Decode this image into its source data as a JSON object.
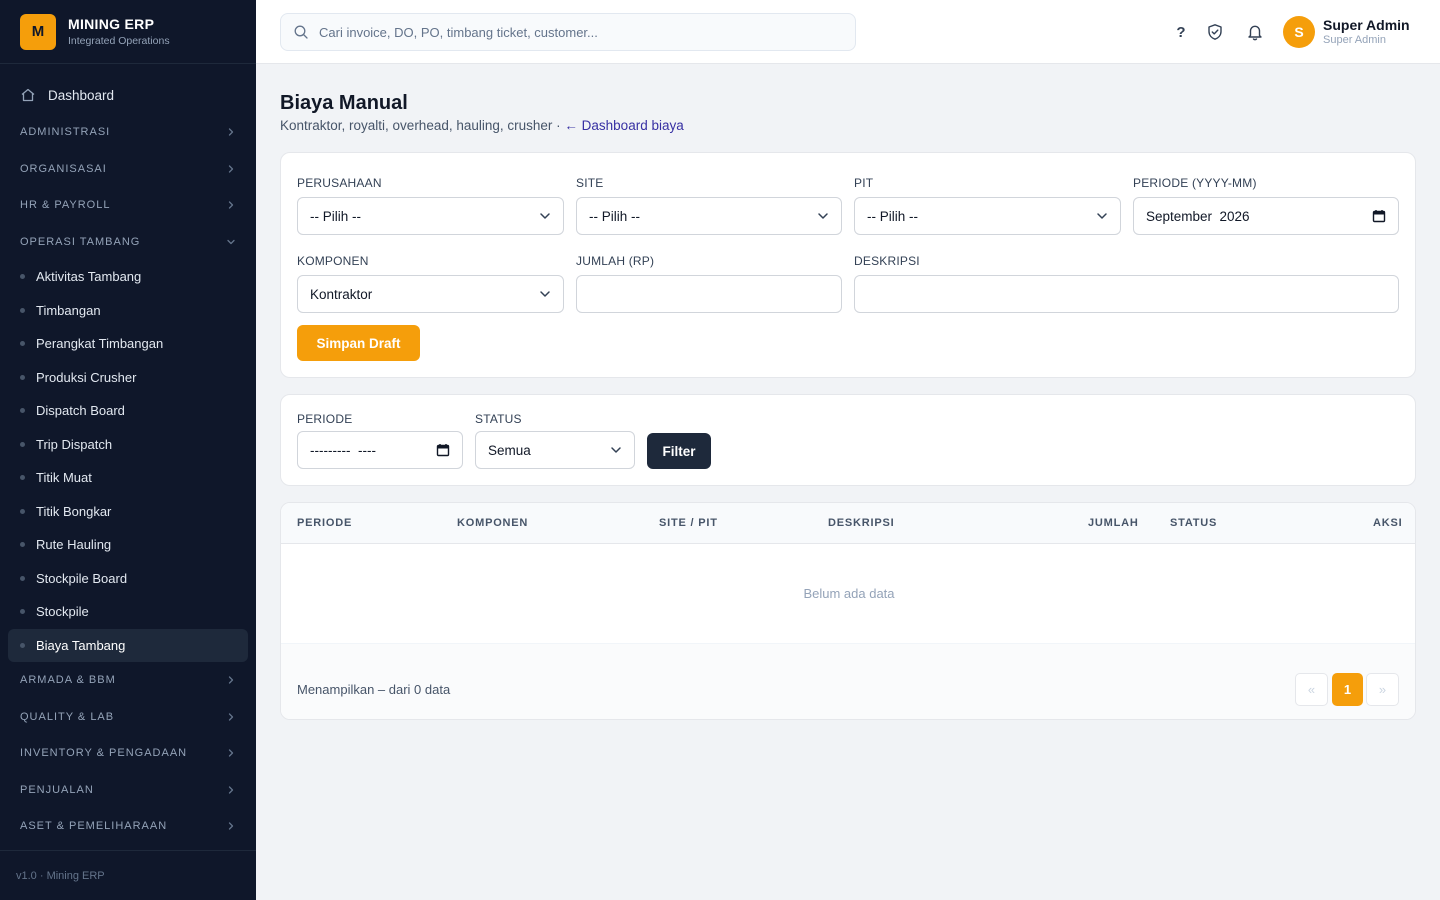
{
  "brand": {
    "logo_letter": "M",
    "title": "MINING ERP",
    "subtitle": "Integrated Operations"
  },
  "sidebar": {
    "dashboard": "Dashboard",
    "groups_top": [
      "ADMINISTRASI",
      "ORGANISASAI",
      "HR & PAYROLL",
      "OPERASI TAMBANG"
    ],
    "operasi_items": [
      "Aktivitas Tambang",
      "Timbangan",
      "Perangkat Timbangan",
      "Produksi Crusher",
      "Dispatch Board",
      "Trip Dispatch",
      "Titik Muat",
      "Titik Bongkar",
      "Rute Hauling",
      "Stockpile Board",
      "Stockpile",
      "Biaya Tambang"
    ],
    "active_item": "Biaya Tambang",
    "groups_bottom": [
      "ARMADA & BBM",
      "QUALITY & LAB",
      "INVENTORY & PENGADAAN",
      "PENJUALAN",
      "ASET & PEMELIHARAAN"
    ],
    "footer": "v1.0 · Mining ERP"
  },
  "topbar": {
    "search_placeholder": "Cari invoice, DO, PO, timbang ticket, customer...",
    "help_glyph": "?",
    "avatar_letter": "S",
    "user_name": "Super Admin",
    "user_role": "Super Admin"
  },
  "page": {
    "title": "Biaya Manual",
    "subtitle": "Kontraktor, royalti, overhead, hauling, crusher · ",
    "back_link": "← Dashboard biaya"
  },
  "form": {
    "perusahaan_label": "PERUSAHAAN",
    "perusahaan_value": "-- Pilih --",
    "site_label": "SITE",
    "site_value": "-- Pilih --",
    "pit_label": "PIT",
    "pit_value": "-- Pilih --",
    "periode_label": "PERIODE (YYYY-MM)",
    "periode_value": "September  2026",
    "komponen_label": "KOMPONEN",
    "komponen_value": "Kontraktor",
    "jumlah_label": "JUMLAH (RP)",
    "jumlah_value": "",
    "deskripsi_label": "DESKRIPSI",
    "deskripsi_value": "",
    "submit": "Simpan Draft"
  },
  "filter": {
    "periode_label": "PERIODE",
    "periode_value": "---------  ----",
    "status_label": "STATUS",
    "status_value": "Semua",
    "button": "Filter"
  },
  "table": {
    "columns": [
      "PERIODE",
      "KOMPONEN",
      "SITE / PIT",
      "DESKRIPSI",
      "JUMLAH",
      "STATUS",
      "AKSI"
    ],
    "empty": "Belum ada data",
    "footer_info": "Menampilkan – dari 0 data",
    "pagination": {
      "prev": "«",
      "current": "1",
      "next": "»"
    }
  },
  "colors": {
    "accent": "#f59e0b",
    "sidebar_bg": "#0f172a",
    "dark_button": "#1e293b"
  }
}
